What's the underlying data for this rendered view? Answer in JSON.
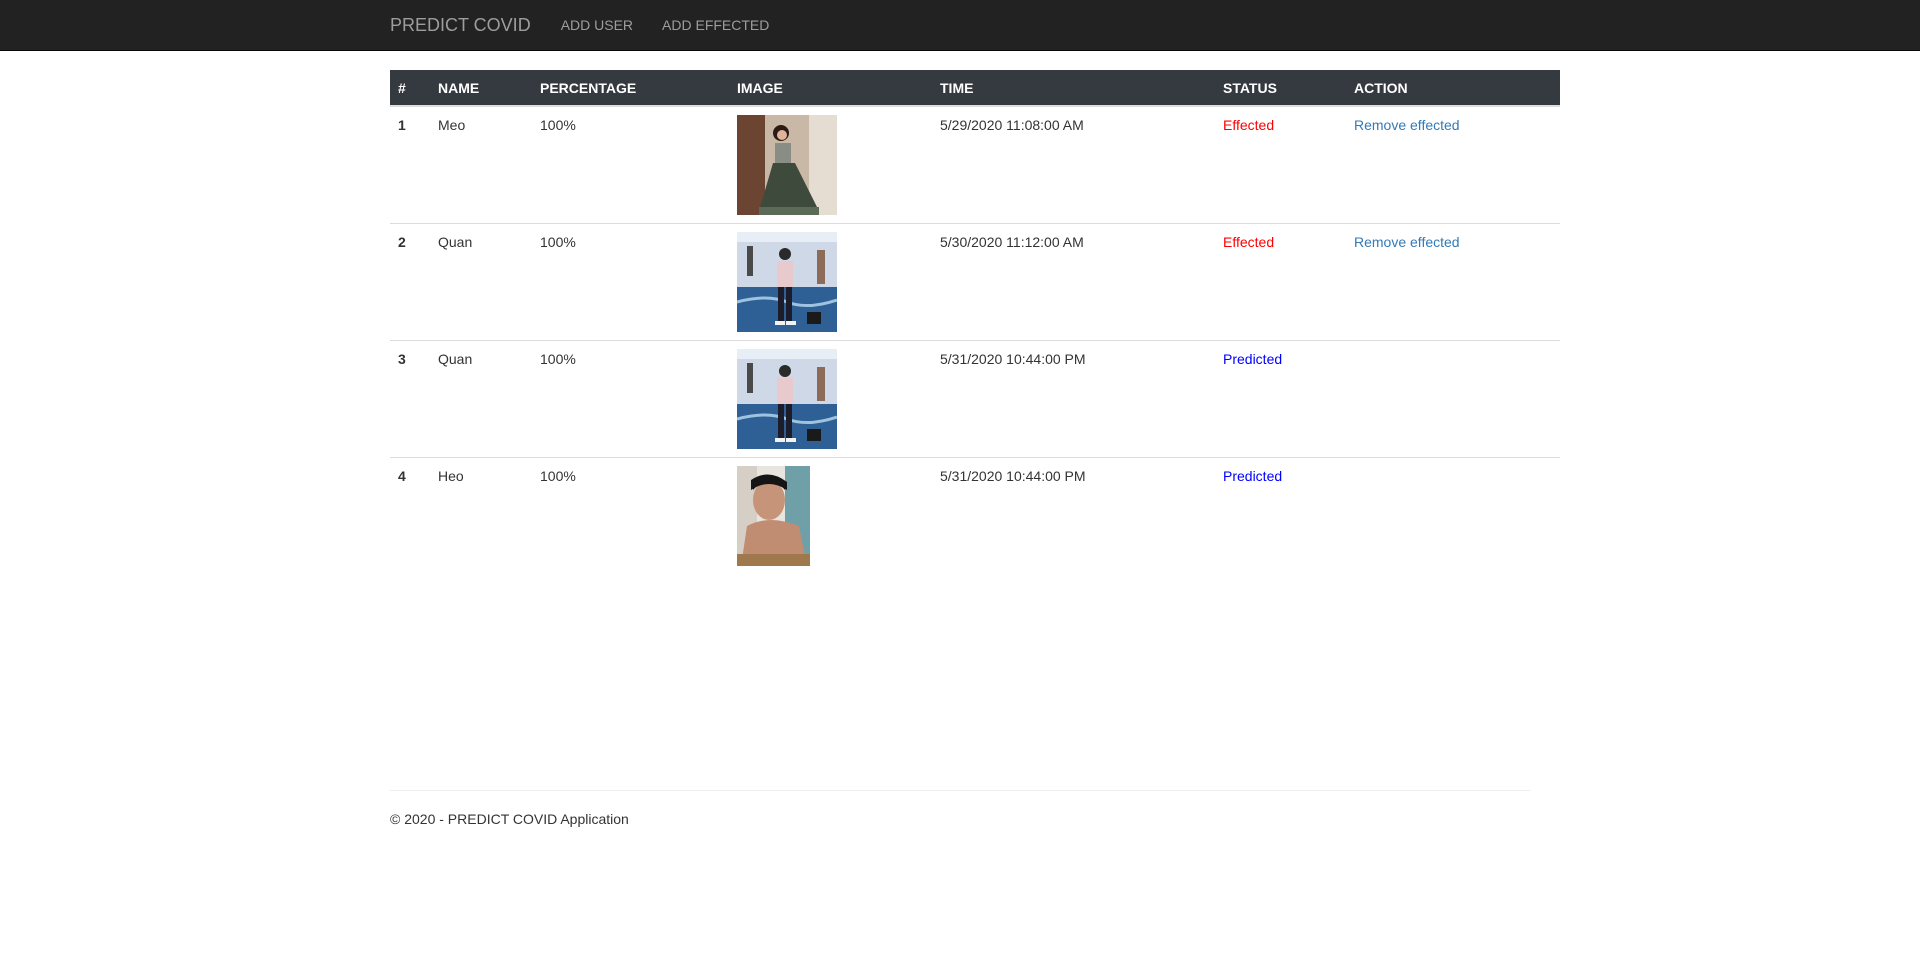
{
  "navbar": {
    "brand": "PREDICT COVID",
    "links": [
      "ADD USER",
      "ADD EFFECTED"
    ]
  },
  "table": {
    "headers": [
      "#",
      "NAME",
      "PERCENTAGE",
      "IMAGE",
      "TIME",
      "STATUS",
      "ACTION"
    ],
    "rows": [
      {
        "num": "1",
        "name": "Meo",
        "percentage": "100%",
        "time": "5/29/2020 11:08:00 AM",
        "status": "Effected",
        "action": "Remove effected"
      },
      {
        "num": "2",
        "name": "Quan",
        "percentage": "100%",
        "time": "5/30/2020 11:12:00 AM",
        "status": "Effected",
        "action": "Remove effected"
      },
      {
        "num": "3",
        "name": "Quan",
        "percentage": "100%",
        "time": "5/31/2020 10:44:00 PM",
        "status": "Predicted",
        "action": ""
      },
      {
        "num": "4",
        "name": "Heo",
        "percentage": "100%",
        "time": "5/31/2020 10:44:00 PM",
        "status": "Predicted",
        "action": ""
      }
    ]
  },
  "footer": {
    "text": "© 2020 - PREDICT COVID Application"
  },
  "colors": {
    "navbar_bg": "#222222",
    "table_header_bg": "#343a40",
    "status_effected": "#ff0000",
    "status_predicted": "#0000ff",
    "link": "#337ab7"
  }
}
